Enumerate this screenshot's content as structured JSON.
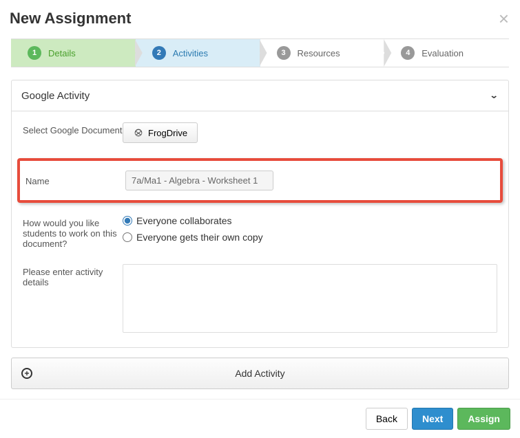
{
  "header": {
    "title": "New Assignment"
  },
  "steps": [
    {
      "num": "1",
      "label": "Details"
    },
    {
      "num": "2",
      "label": "Activities"
    },
    {
      "num": "3",
      "label": "Resources"
    },
    {
      "num": "4",
      "label": "Evaluation"
    }
  ],
  "panel": {
    "title": "Google Activity",
    "select_doc_label": "Select Google Document",
    "frogdrive_label": "FrogDrive",
    "name_label": "Name",
    "name_value": "7a/Ma1 - Algebra - Worksheet 1",
    "work_label": "How would you like students to work on this document?",
    "radio1": "Everyone collaborates",
    "radio2": "Everyone gets their own copy",
    "details_label": "Please enter activity details"
  },
  "add_activity_label": "Add Activity",
  "footer": {
    "back": "Back",
    "next": "Next",
    "assign": "Assign"
  }
}
